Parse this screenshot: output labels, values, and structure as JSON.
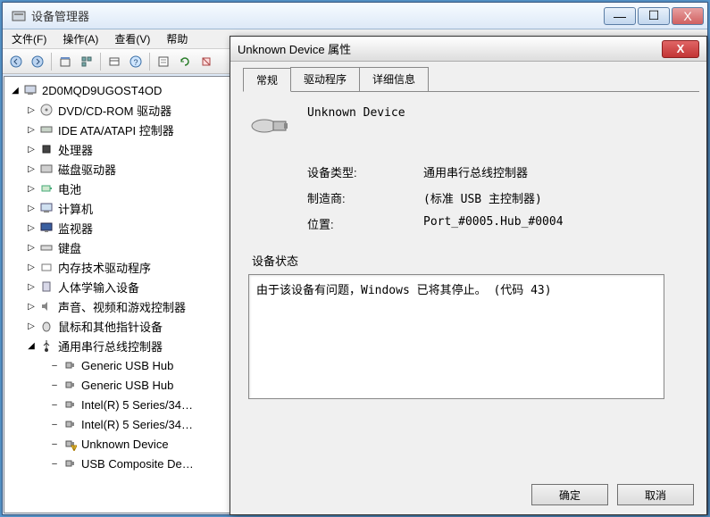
{
  "window": {
    "title": "设备管理器",
    "controls": {
      "min": "—",
      "max": "☐",
      "close": "X"
    }
  },
  "menu": {
    "file": "文件(F)",
    "action": "操作(A)",
    "view": "查看(V)",
    "help": "帮助"
  },
  "toolbar_icons": [
    "back",
    "forward",
    "up",
    "organize",
    "view",
    "help",
    "properties",
    "refresh",
    "uninstall"
  ],
  "tree": {
    "root": "2D0MQD9UGOST4OD",
    "nodes": [
      {
        "label": "DVD/CD-ROM 驱动器",
        "icon": "disc"
      },
      {
        "label": "IDE ATA/ATAPI 控制器",
        "icon": "ide"
      },
      {
        "label": "处理器",
        "icon": "cpu"
      },
      {
        "label": "磁盘驱动器",
        "icon": "disk"
      },
      {
        "label": "电池",
        "icon": "battery"
      },
      {
        "label": "计算机",
        "icon": "computer"
      },
      {
        "label": "监视器",
        "icon": "monitor"
      },
      {
        "label": "键盘",
        "icon": "keyboard"
      },
      {
        "label": "内存技术驱动程序",
        "icon": "card"
      },
      {
        "label": "人体学输入设备",
        "icon": "hid"
      },
      {
        "label": "声音、视频和游戏控制器",
        "icon": "sound"
      },
      {
        "label": "鼠标和其他指针设备",
        "icon": "mouse"
      },
      {
        "label": "通用串行总线控制器",
        "icon": "usb",
        "expanded": true,
        "children": [
          {
            "label": "Generic USB Hub",
            "icon": "usb-plug"
          },
          {
            "label": "Generic USB Hub",
            "icon": "usb-plug"
          },
          {
            "label": "Intel(R) 5 Series/34…",
            "icon": "usb-plug"
          },
          {
            "label": "Intel(R) 5 Series/34…",
            "icon": "usb-plug"
          },
          {
            "label": "Unknown Device",
            "icon": "usb-plug-warn"
          },
          {
            "label": "USB Composite De…",
            "icon": "usb-plug"
          }
        ]
      }
    ]
  },
  "dialog": {
    "title": "Unknown Device 属性",
    "tabs": {
      "general": "常规",
      "driver": "驱动程序",
      "details": "详细信息"
    },
    "device_name": "Unknown Device",
    "rows": {
      "type_label": "设备类型:",
      "type_value": "通用串行总线控制器",
      "mfg_label": "制造商:",
      "mfg_value": "(标准 USB 主控制器)",
      "loc_label": "位置:",
      "loc_value": "Port_#0005.Hub_#0004"
    },
    "status_label": "设备状态",
    "status_text": "由于该设备有问题，Windows 已将其停止。 (代码 43)",
    "buttons": {
      "ok": "确定",
      "cancel": "取消"
    },
    "close_glyph": "X"
  }
}
